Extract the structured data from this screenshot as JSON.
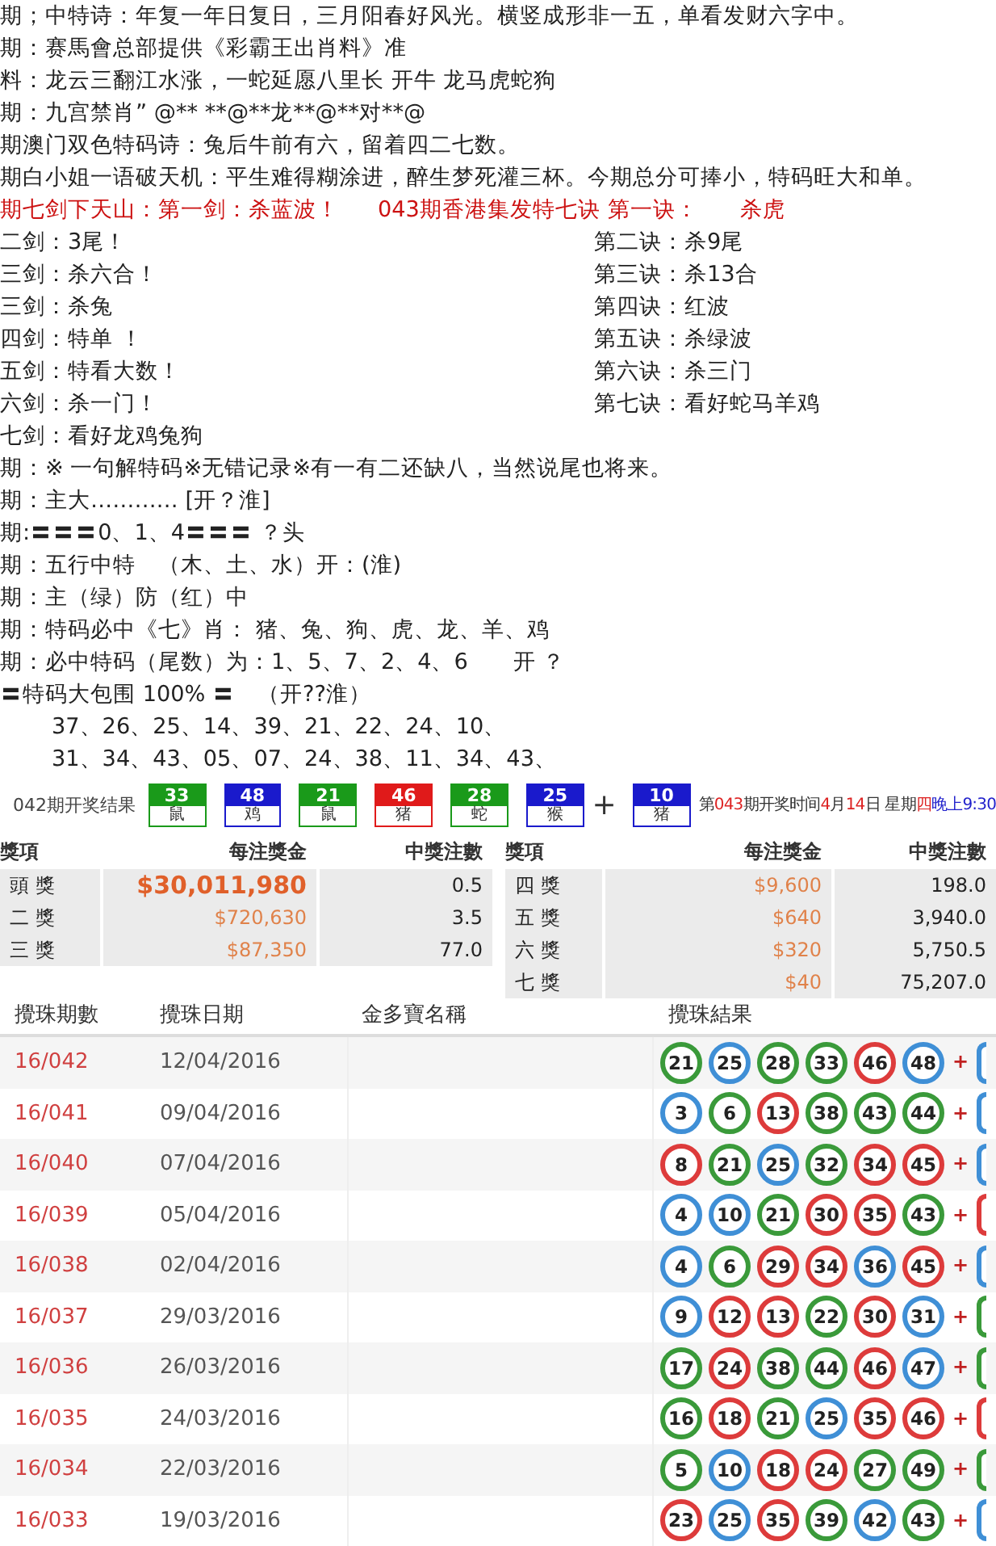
{
  "poem_lines": [
    "期；中特诗：年复一年日复日，三月阳春好风光。横竖成形非一五，单看发财六字中。",
    "期：赛馬會总部提供《彩霸王出肖料》准",
    "料：龙云三翻江水涨，一蛇延愿八里长 开牛 龙马虎蛇狗",
    "期：九宫禁肖” @** **@**龙**@**对**@",
    "期澳门双色特码诗：兔后牛前有六，留着四二七数。",
    "期白小姐一语破天机：平生难得糊涂进，醉生梦死灌三杯。今期总分可捧小，特码旺大和单。"
  ],
  "swords_title": "期七剑下天山：第一剑：杀蓝波！",
  "jue_title": "043期香港集发特七诀 第一诀：",
  "jue_first": "杀虎",
  "swords": [
    "二剑：3尾！",
    "三剑：杀六合！",
    "三剑：杀兔",
    "四剑：特单 ！",
    "五剑：特看大数！",
    "六剑：杀一门！",
    "七剑：看好龙鸡兔狗"
  ],
  "jue": [
    "第二诀：杀9尾",
    "第三诀：杀13合",
    "第四诀：红波",
    "第五诀：杀绿波",
    "第六诀：杀三门",
    "第七诀：看好蛇马羊鸡"
  ],
  "tip_lines": [
    "期：※ 一句解特码※无错记录※有一有二还缺八，当然说尾也将来。",
    "期：主大………… [开？淮]",
    "期:〓〓〓0、1、4〓〓〓 ？头",
    "期：五行中特　（木、土、水）开：(淮)",
    "期：主（绿）防（红）中",
    "期：特码必中《七》肖： 猪、兔、狗、虎、龙、羊、鸡",
    "期：必中特码（尾数）为：1、5、7、2、4、6　　开 ？",
    "〓特码大包围 100% 〓　（开??淮）"
  ],
  "number_lines": [
    "37、26、25、14、39、21、22、24、10、",
    "31、34、43、05、07、24、38、11、34、43、"
  ],
  "draw": {
    "title": "042期开奖结果",
    "balls": [
      {
        "n": "33",
        "zodiac": "鼠",
        "color": "#1a9a1a"
      },
      {
        "n": "48",
        "zodiac": "鸡",
        "color": "#1a1acc"
      },
      {
        "n": "21",
        "zodiac": "鼠",
        "color": "#1a9a1a"
      },
      {
        "n": "46",
        "zodiac": "猪",
        "color": "#e01a1a"
      },
      {
        "n": "28",
        "zodiac": "蛇",
        "color": "#1a9a1a"
      },
      {
        "n": "25",
        "zodiac": "猴",
        "color": "#1a1acc"
      }
    ],
    "plus": "+",
    "special": {
      "n": "10",
      "zodiac": "猪",
      "color": "#1a1acc"
    },
    "next_draw": [
      {
        "text": "第",
        "color": "#333333"
      },
      {
        "text": "043",
        "color": "#dd2222"
      },
      {
        "text": "期开奖时间",
        "color": "#333333"
      },
      {
        "text": "4",
        "color": "#dd2222"
      },
      {
        "text": "月",
        "color": "#333333"
      },
      {
        "text": "14",
        "color": "#dd2222"
      },
      {
        "text": "日 星期",
        "color": "#333333"
      },
      {
        "text": "四",
        "color": "#dd2222"
      },
      {
        "text": "晚上",
        "color": "#2222cc"
      },
      {
        "text": "9:30",
        "color": "#2222cc"
      }
    ]
  },
  "prizes": {
    "columns": [
      "獎項",
      "每注獎金",
      "中獎注數"
    ],
    "left_rows": [
      {
        "prize": "頭 獎",
        "amount": "$30,011,980",
        "bets": "0.5",
        "kind": "jackpot"
      },
      {
        "prize": "二 獎",
        "amount": "$720,630",
        "bets": "3.5",
        "kind": "normal"
      },
      {
        "prize": "三 獎",
        "amount": "$87,350",
        "bets": "77.0",
        "kind": "normal"
      }
    ],
    "right_columns": [
      "獎項",
      "每注獎金",
      "中獎注數"
    ],
    "right_rows": [
      {
        "prize": "四 獎",
        "amount": "$9,600",
        "bets": "198.0",
        "kind": "normal"
      },
      {
        "prize": "五 獎",
        "amount": "$640",
        "bets": "3,940.0",
        "kind": "normal"
      },
      {
        "prize": "六 獎",
        "amount": "$320",
        "bets": "5,750.5",
        "kind": "normal"
      },
      {
        "prize": "七 獎",
        "amount": "$40",
        "bets": "75,207.0",
        "kind": "normal"
      }
    ]
  },
  "results": {
    "columns": [
      "攪珠期數",
      "攪珠日期",
      "金多寶名稱",
      "攪珠結果"
    ],
    "rows": [
      {
        "period": "16/042",
        "date": "12/04/2016",
        "balls": [
          {
            "n": "21",
            "color": "#3a9a3a"
          },
          {
            "n": "25",
            "color": "#3f8fd6"
          },
          {
            "n": "28",
            "color": "#3a9a3a"
          },
          {
            "n": "33",
            "color": "#3a9a3a"
          },
          {
            "n": "46",
            "color": "#dd3b3b"
          },
          {
            "n": "48",
            "color": "#3f8fd6"
          }
        ],
        "plus": "+",
        "extra_ball": {
          "color": "#3f8fd6"
        }
      },
      {
        "period": "16/041",
        "date": "09/04/2016",
        "balls": [
          {
            "n": "3",
            "color": "#3f8fd6"
          },
          {
            "n": "6",
            "color": "#3a9a3a"
          },
          {
            "n": "13",
            "color": "#dd3b3b"
          },
          {
            "n": "38",
            "color": "#3a9a3a"
          },
          {
            "n": "43",
            "color": "#3a9a3a"
          },
          {
            "n": "44",
            "color": "#3a9a3a"
          }
        ],
        "plus": "+",
        "extra_ball": {
          "color": "#3f8fd6"
        }
      },
      {
        "period": "16/040",
        "date": "07/04/2016",
        "balls": [
          {
            "n": "8",
            "color": "#dd3b3b"
          },
          {
            "n": "21",
            "color": "#3a9a3a"
          },
          {
            "n": "25",
            "color": "#3f8fd6"
          },
          {
            "n": "32",
            "color": "#3a9a3a"
          },
          {
            "n": "34",
            "color": "#dd3b3b"
          },
          {
            "n": "45",
            "color": "#dd3b3b"
          }
        ],
        "plus": "+",
        "extra_ball": {
          "color": "#3f8fd6"
        }
      },
      {
        "period": "16/039",
        "date": "05/04/2016",
        "balls": [
          {
            "n": "4",
            "color": "#3f8fd6"
          },
          {
            "n": "10",
            "color": "#3f8fd6"
          },
          {
            "n": "21",
            "color": "#3a9a3a"
          },
          {
            "n": "30",
            "color": "#dd3b3b"
          },
          {
            "n": "35",
            "color": "#dd3b3b"
          },
          {
            "n": "43",
            "color": "#3a9a3a"
          }
        ],
        "plus": "+",
        "extra_ball": {
          "color": "#dd3b3b"
        }
      },
      {
        "period": "16/038",
        "date": "02/04/2016",
        "balls": [
          {
            "n": "4",
            "color": "#3f8fd6"
          },
          {
            "n": "6",
            "color": "#3a9a3a"
          },
          {
            "n": "29",
            "color": "#dd3b3b"
          },
          {
            "n": "34",
            "color": "#dd3b3b"
          },
          {
            "n": "36",
            "color": "#3f8fd6"
          },
          {
            "n": "45",
            "color": "#dd3b3b"
          }
        ],
        "plus": "+",
        "extra_ball": {
          "color": "#3f8fd6"
        }
      },
      {
        "period": "16/037",
        "date": "29/03/2016",
        "balls": [
          {
            "n": "9",
            "color": "#3f8fd6"
          },
          {
            "n": "12",
            "color": "#dd3b3b"
          },
          {
            "n": "13",
            "color": "#dd3b3b"
          },
          {
            "n": "22",
            "color": "#3a9a3a"
          },
          {
            "n": "30",
            "color": "#dd3b3b"
          },
          {
            "n": "31",
            "color": "#3f8fd6"
          }
        ],
        "plus": "+",
        "extra_ball": {
          "color": "#3a9a3a"
        }
      },
      {
        "period": "16/036",
        "date": "26/03/2016",
        "balls": [
          {
            "n": "17",
            "color": "#3a9a3a"
          },
          {
            "n": "24",
            "color": "#dd3b3b"
          },
          {
            "n": "38",
            "color": "#3a9a3a"
          },
          {
            "n": "44",
            "color": "#3a9a3a"
          },
          {
            "n": "46",
            "color": "#dd3b3b"
          },
          {
            "n": "47",
            "color": "#3f8fd6"
          }
        ],
        "plus": "+",
        "extra_ball": {
          "color": "#3a9a3a"
        }
      },
      {
        "period": "16/035",
        "date": "24/03/2016",
        "balls": [
          {
            "n": "16",
            "color": "#3a9a3a"
          },
          {
            "n": "18",
            "color": "#dd3b3b"
          },
          {
            "n": "21",
            "color": "#3a9a3a"
          },
          {
            "n": "25",
            "color": "#3f8fd6"
          },
          {
            "n": "35",
            "color": "#dd3b3b"
          },
          {
            "n": "46",
            "color": "#dd3b3b"
          }
        ],
        "plus": "+",
        "extra_ball": {
          "color": "#dd3b3b"
        }
      },
      {
        "period": "16/034",
        "date": "22/03/2016",
        "balls": [
          {
            "n": "5",
            "color": "#3a9a3a"
          },
          {
            "n": "10",
            "color": "#3f8fd6"
          },
          {
            "n": "18",
            "color": "#dd3b3b"
          },
          {
            "n": "24",
            "color": "#dd3b3b"
          },
          {
            "n": "27",
            "color": "#3a9a3a"
          },
          {
            "n": "49",
            "color": "#3a9a3a"
          }
        ],
        "plus": "+",
        "extra_ball": {
          "color": "#3a9a3a"
        }
      },
      {
        "period": "16/033",
        "date": "19/03/2016",
        "balls": [
          {
            "n": "23",
            "color": "#dd3b3b"
          },
          {
            "n": "25",
            "color": "#3f8fd6"
          },
          {
            "n": "35",
            "color": "#dd3b3b"
          },
          {
            "n": "39",
            "color": "#3a9a3a"
          },
          {
            "n": "42",
            "color": "#3f8fd6"
          },
          {
            "n": "43",
            "color": "#3a9a3a"
          }
        ],
        "plus": "+",
        "extra_ball": {
          "color": "#3f8fd6"
        }
      }
    ]
  }
}
